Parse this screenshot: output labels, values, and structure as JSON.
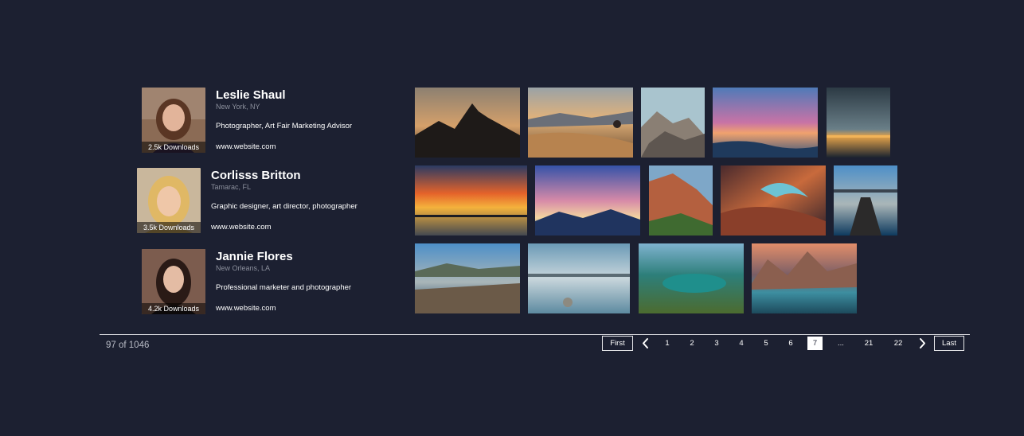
{
  "profiles": [
    {
      "name": "Leslie Shaul",
      "location": "New York, NY",
      "bio": "Photographer, Art Fair Marketing Advisor",
      "website": "www.website.com",
      "downloads": "2.5k Downloads"
    },
    {
      "name": "Corlisss Britton",
      "location": "Tamarac, FL",
      "bio": "Graphic designer, art director, photographer",
      "website": "www.website.com",
      "downloads": "3.5k Downloads"
    },
    {
      "name": "Jannie Flores",
      "location": "New Orleans, LA",
      "bio": "Professional marketer and photographer",
      "website": "www.website.com",
      "downloads": "4.2k Downloads"
    }
  ],
  "photos_row_1": [
    "mountain-silhouette-sunset",
    "desert-dunes-person",
    "rocky-cliff",
    "pink-sunset-beach",
    "dark-sky-coast-lights"
  ],
  "photos_row_2": [
    "fiery-sunset-lake",
    "purple-cloud-mountains",
    "red-canyon-waterfall",
    "antelope-canyon",
    "lake-pier"
  ],
  "photos_row_3": [
    "railway-lake-mountains",
    "calm-lake-stones",
    "emerald-bay",
    "moraine-lake-sunset"
  ],
  "footer": {
    "result_count": "97 of 1046",
    "first_label": "First",
    "last_label": "Last",
    "pages": [
      "1",
      "2",
      "3",
      "4",
      "5",
      "6",
      "7",
      "...",
      "21",
      "22"
    ],
    "current_page": "7"
  },
  "colors": {
    "background": "#1c2031",
    "text": "#ffffff",
    "muted": "#8b8f9c"
  },
  "icons": {
    "prev": "chevron-left-icon",
    "next": "chevron-right-icon"
  }
}
